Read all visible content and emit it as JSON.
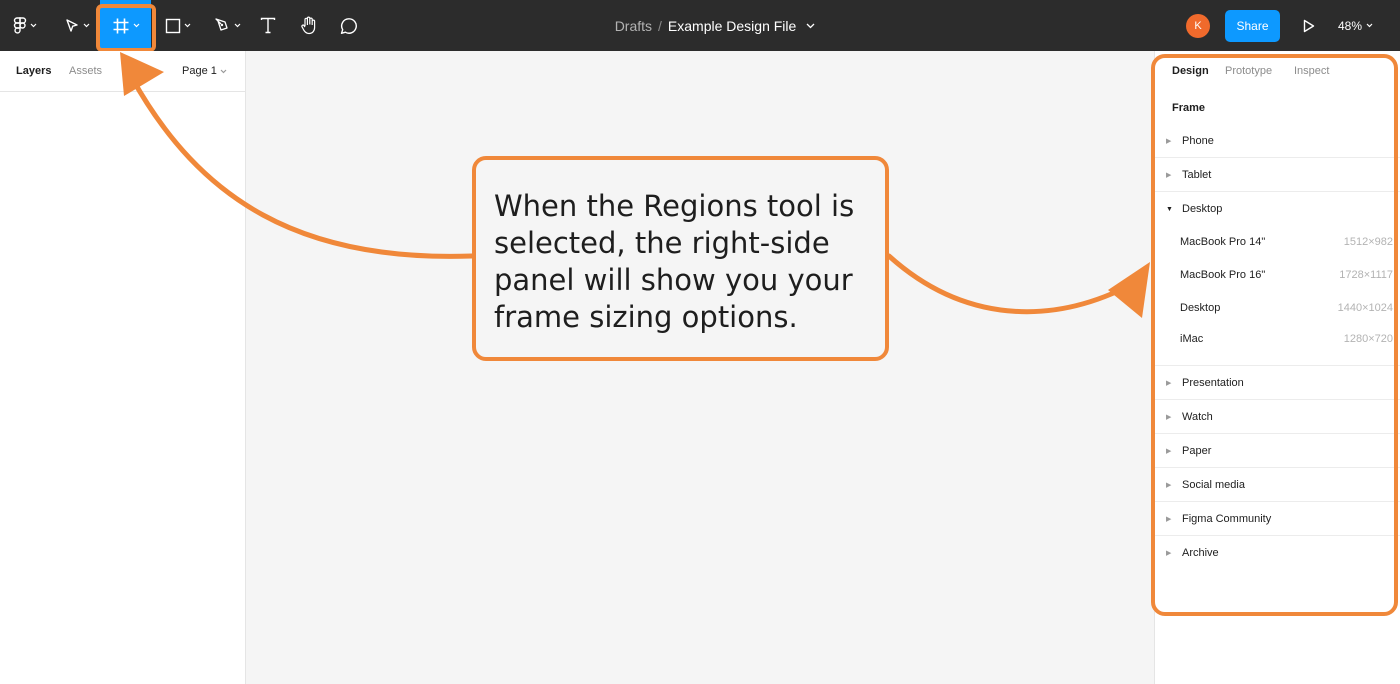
{
  "toolbar": {
    "breadcrumb_team": "Drafts",
    "breadcrumb_separator": "/",
    "file_name": "Example Design File",
    "avatar_initial": "K",
    "share_label": "Share",
    "zoom": "48%",
    "tools": [
      "main-menu-icon",
      "move-icon",
      "frame-icon",
      "shape-icon",
      "pen-icon",
      "text-icon",
      "hand-icon",
      "comment-icon"
    ],
    "selected_tool": "frame-icon",
    "accent_color": "#0d99ff"
  },
  "left_panel": {
    "tabs": {
      "layers": "Layers",
      "assets": "Assets"
    },
    "page": "Page 1"
  },
  "right_panel": {
    "tabs": {
      "design": "Design",
      "prototype": "Prototype",
      "inspect": "Inspect"
    },
    "section_title": "Frame",
    "groups_before": [
      "Phone",
      "Tablet"
    ],
    "expanded_group": "Desktop",
    "presets": [
      {
        "name": "MacBook Pro 14\"",
        "size": "1512×982"
      },
      {
        "name": "MacBook Pro 16\"",
        "size": "1728×1117"
      },
      {
        "name": "Desktop",
        "size": "1440×1024"
      },
      {
        "name": "iMac",
        "size": "1280×720"
      }
    ],
    "groups_after": [
      "Presentation",
      "Watch",
      "Paper",
      "Social media",
      "Figma Community",
      "Archive"
    ]
  },
  "annotation": {
    "text": "When the Regions tool is\nselected, the right-side\npanel will show you your\nframe sizing options.",
    "color": "#f0883a"
  }
}
